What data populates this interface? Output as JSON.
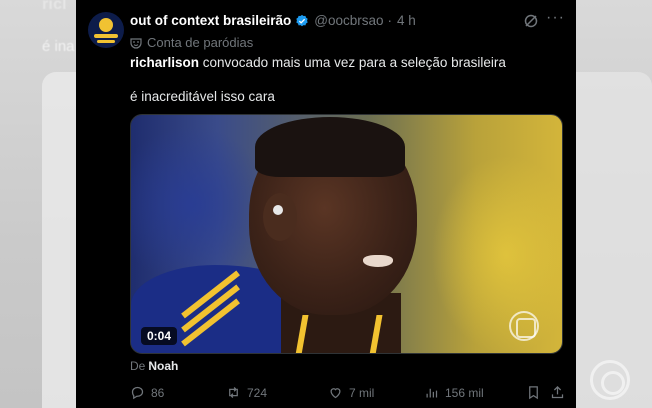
{
  "background": {
    "title_fragment": "ricl",
    "text_fragment": "é ina"
  },
  "tweet": {
    "display_name": "out of context brasileirão",
    "handle": "@oocbrsao",
    "separator": "·",
    "time": "4 h",
    "parody_label": "Conta de paródias",
    "mention": "richarlison",
    "text_line_1": " convocado mais uma vez para a seleção brasileira",
    "text_line_2": "é inacreditável isso cara",
    "media": {
      "duration": "0:04",
      "icon": "watermark-icon"
    },
    "from_prefix": "De",
    "from_name": "Noah",
    "actions": {
      "replies": "86",
      "reposts": "724",
      "likes": "7 mil",
      "views": "156 mil"
    }
  },
  "colors": {
    "card_bg": "#000000",
    "verified": "#1d9bf0",
    "muted": "#71767b",
    "text": "#e7e9ea"
  },
  "icons": [
    "verified-icon",
    "parody-icon",
    "grok-icon",
    "more-icon",
    "reply-icon",
    "repost-icon",
    "like-icon",
    "views-icon",
    "bookmark-icon",
    "share-icon"
  ]
}
